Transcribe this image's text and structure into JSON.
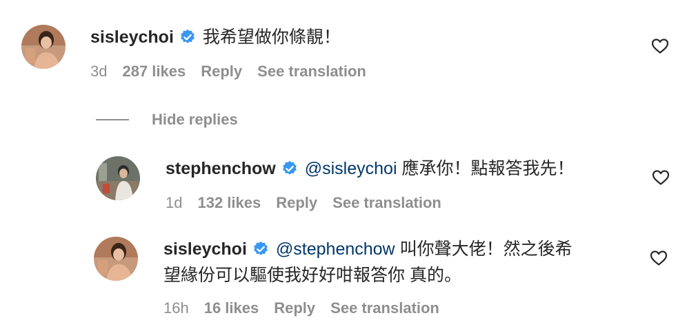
{
  "comments": [
    {
      "username": "sisleychoi",
      "verified": true,
      "mention": "",
      "text": "我希望做你條靚！",
      "time": "3d",
      "likes": "287 likes",
      "reply_label": "Reply",
      "translation_label": "See translation"
    },
    {
      "username": "stephenchow",
      "verified": true,
      "mention": "@sisleychoi",
      "text": "應承你！點報答我先！",
      "time": "1d",
      "likes": "132 likes",
      "reply_label": "Reply",
      "translation_label": "See translation"
    },
    {
      "username": "sisleychoi",
      "verified": true,
      "mention": "@stephenchow",
      "text": "叫你聲大佬！然之後希",
      "text_line2": "望緣份可以驅使我好好咁報答你 真的。",
      "time": "16h",
      "likes": "16 likes",
      "reply_label": "Reply",
      "translation_label": "See translation"
    }
  ],
  "hide_replies_label": "Hide replies",
  "colors": {
    "text": "#262626",
    "muted": "#8e8e8e",
    "mention": "#00376b",
    "verified": "#3897f0"
  },
  "icons": {
    "verified": "verified-badge-icon",
    "like": "heart-outline-icon"
  }
}
